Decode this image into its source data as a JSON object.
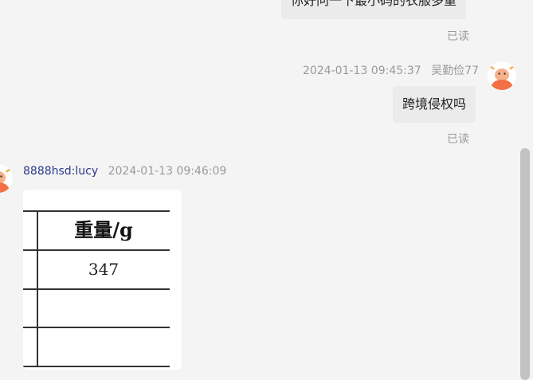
{
  "messages": {
    "top_partial": {
      "text": "你好问一下最小码的衣服多重",
      "status": "已读"
    },
    "outgoing": {
      "timestamp": "2024-01-13 09:45:37",
      "sender": "吴勤俭77",
      "text": "跨境侵权吗",
      "status": "已读"
    },
    "incoming": {
      "sender": "8888hsd:lucy",
      "timestamp": "2024-01-13 09:46:09",
      "image": {
        "header": "重量/g",
        "rows": [
          "347",
          "",
          ""
        ]
      }
    }
  },
  "colors": {
    "background": "#f4f4f4",
    "bubble": "#ebebeb",
    "sender_name": "#2b3a8c",
    "avatar_accent": "#f27043"
  }
}
